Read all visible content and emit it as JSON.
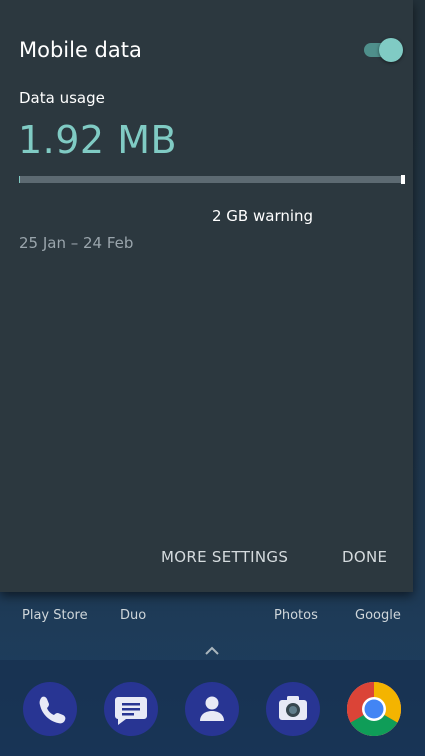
{
  "dialog": {
    "title": "Mobile data",
    "toggle_on": true,
    "usage_label": "Data usage",
    "usage_value": "1.92 MB",
    "usage_fraction": 0.001,
    "warning_label": "2 GB warning",
    "date_range": "25 Jan – 24 Feb",
    "more_settings_label": "MORE SETTINGS",
    "done_label": "DONE"
  },
  "home": {
    "labels": [
      "Play Store",
      "Duo",
      "Photos",
      "Google"
    ],
    "dock": [
      "phone-icon",
      "messages-icon",
      "contacts-icon",
      "camera-icon",
      "chrome-icon"
    ]
  },
  "colors": {
    "accent": "#80cbc4",
    "panel": "#2c383f",
    "dock_icon_bg": "#283593"
  }
}
